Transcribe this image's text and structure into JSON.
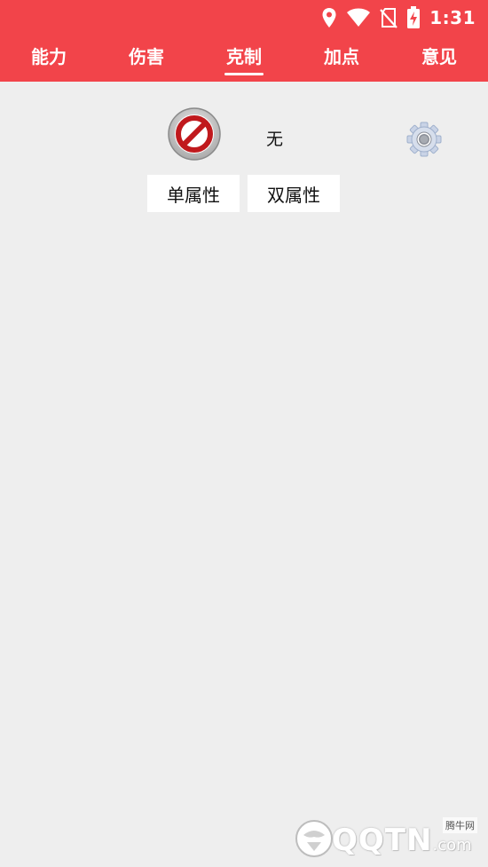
{
  "status_bar": {
    "time": "1:31",
    "icons": [
      "location-icon",
      "wifi-icon",
      "no-sim-icon",
      "battery-charging-icon"
    ]
  },
  "tabs": [
    {
      "label": "能力",
      "active": false
    },
    {
      "label": "伤害",
      "active": false
    },
    {
      "label": "克制",
      "active": true
    },
    {
      "label": "加点",
      "active": false
    },
    {
      "label": "意见",
      "active": false
    }
  ],
  "selection": {
    "icon": "no-entry-icon",
    "type_name": "无"
  },
  "buttons": {
    "single": "单属性",
    "dual": "双属性"
  },
  "settings_icon": "gear-icon",
  "watermark": {
    "brand": "QQTN",
    "suffix": ".com",
    "tag": "腾牛网"
  },
  "colors": {
    "accent": "#f2444a",
    "background": "#eeeeee",
    "button_bg": "#ffffff"
  }
}
